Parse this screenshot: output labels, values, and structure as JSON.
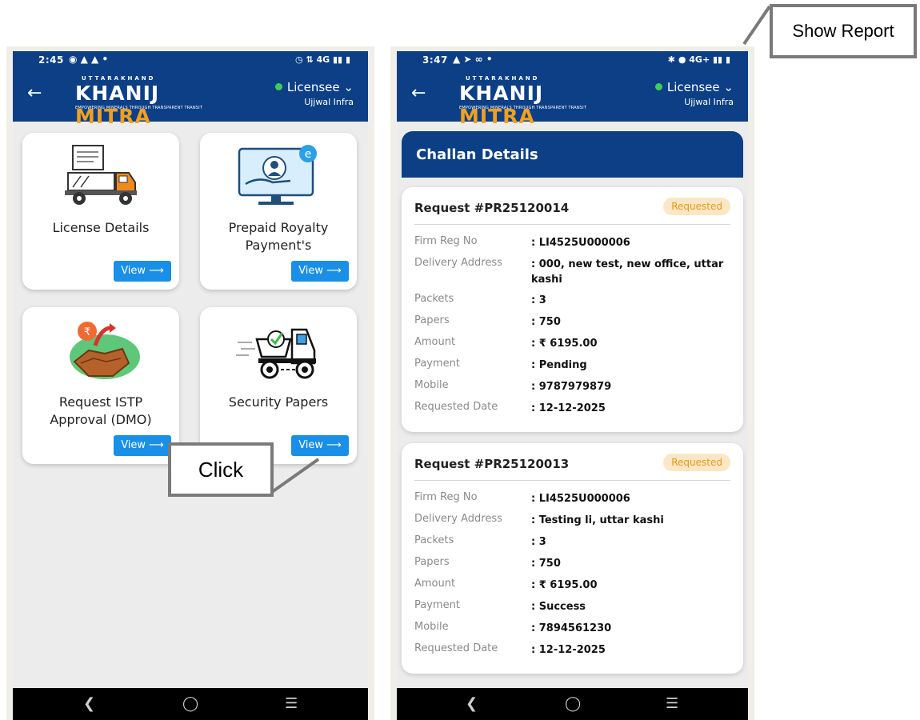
{
  "app": {
    "logo_top": "UTTARAKHAND",
    "logo_main_1": "KHANIJ ",
    "logo_main_2": "MITRA",
    "logo_tagline": "EMPOWERING MINERALS THROUGH TRANSPARENT TRANSIT",
    "role": "Licensee",
    "company": "Ujjwal Infra"
  },
  "left_screen": {
    "status": {
      "time": "2:45",
      "network": "4G"
    },
    "tiles": [
      {
        "label": "License Details",
        "button": "View ⟶",
        "icon": "truck-icon"
      },
      {
        "label": "Prepaid Royalty Payment's",
        "button": "View ⟶",
        "icon": "payment-monitor-icon"
      },
      {
        "label": "Request ISTP Approval (DMO)",
        "button": "View ⟶",
        "icon": "rupee-mineral-icon"
      },
      {
        "label": "Security Papers",
        "button": "View ⟶",
        "icon": "dumper-truck-icon"
      }
    ]
  },
  "right_screen": {
    "status": {
      "time": "3:47",
      "network": "4G+"
    },
    "section_title": "Challan Details",
    "field_labels": {
      "firm": "Firm Reg No",
      "address": "Delivery Address",
      "packets": "Packets",
      "papers": "Papers",
      "amount": "Amount",
      "payment": "Payment",
      "mobile": "Mobile",
      "date": "Requested Date"
    },
    "requests": [
      {
        "id": "Request #PR25120014",
        "status": "Requested",
        "firm": ": LI4525U000006",
        "address": ": 000, new test, new office, uttar kashi",
        "packets": ": 3",
        "papers": ": 750",
        "amount": ": ₹ 6195.00",
        "payment": ": Pending",
        "mobile": ": 9787979879",
        "date": ": 12-12-2025"
      },
      {
        "id": "Request #PR25120013",
        "status": "Requested",
        "firm": ": LI4525U000006",
        "address": ": Testing li, uttar kashi",
        "packets": ": 3",
        "papers": ": 750",
        "amount": ": ₹ 6195.00",
        "payment": ": Success",
        "mobile": ": 7894561230",
        "date": ": 12-12-2025"
      }
    ]
  },
  "annotations": {
    "click": "Click",
    "show_report": "Show Report"
  }
}
